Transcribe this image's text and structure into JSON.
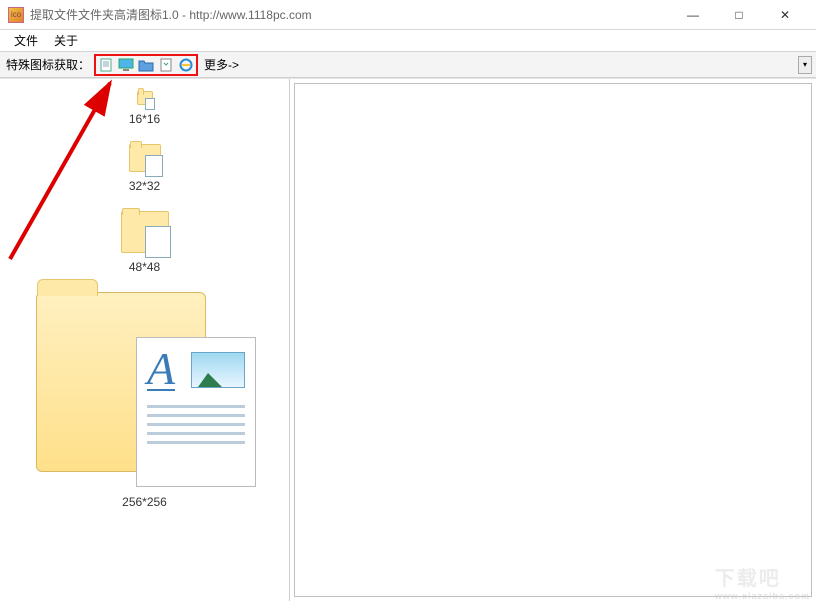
{
  "titlebar": {
    "app_icon_text": "ico",
    "title": "提取文件文件夹高清图标1.0 - http://www.1118pc.com",
    "min": "—",
    "max": "□",
    "close": "✕"
  },
  "menubar": {
    "file": "文件",
    "about": "关于"
  },
  "toolbar": {
    "label": "特殊图标获取：",
    "icons": {
      "doc": "document-icon",
      "monitor": "monitor-icon",
      "folder": "folder-icon",
      "recycle": "recycle-bin-icon",
      "ie": "internet-explorer-icon"
    },
    "more": "更多->",
    "dropdown": "▾"
  },
  "left_pane": {
    "items": [
      {
        "label": "16*16"
      },
      {
        "label": "32*32"
      },
      {
        "label": "48*48"
      },
      {
        "label": "256*256"
      }
    ]
  },
  "watermark": {
    "main": "下载吧",
    "sub": "www.xiazaiba.com"
  }
}
